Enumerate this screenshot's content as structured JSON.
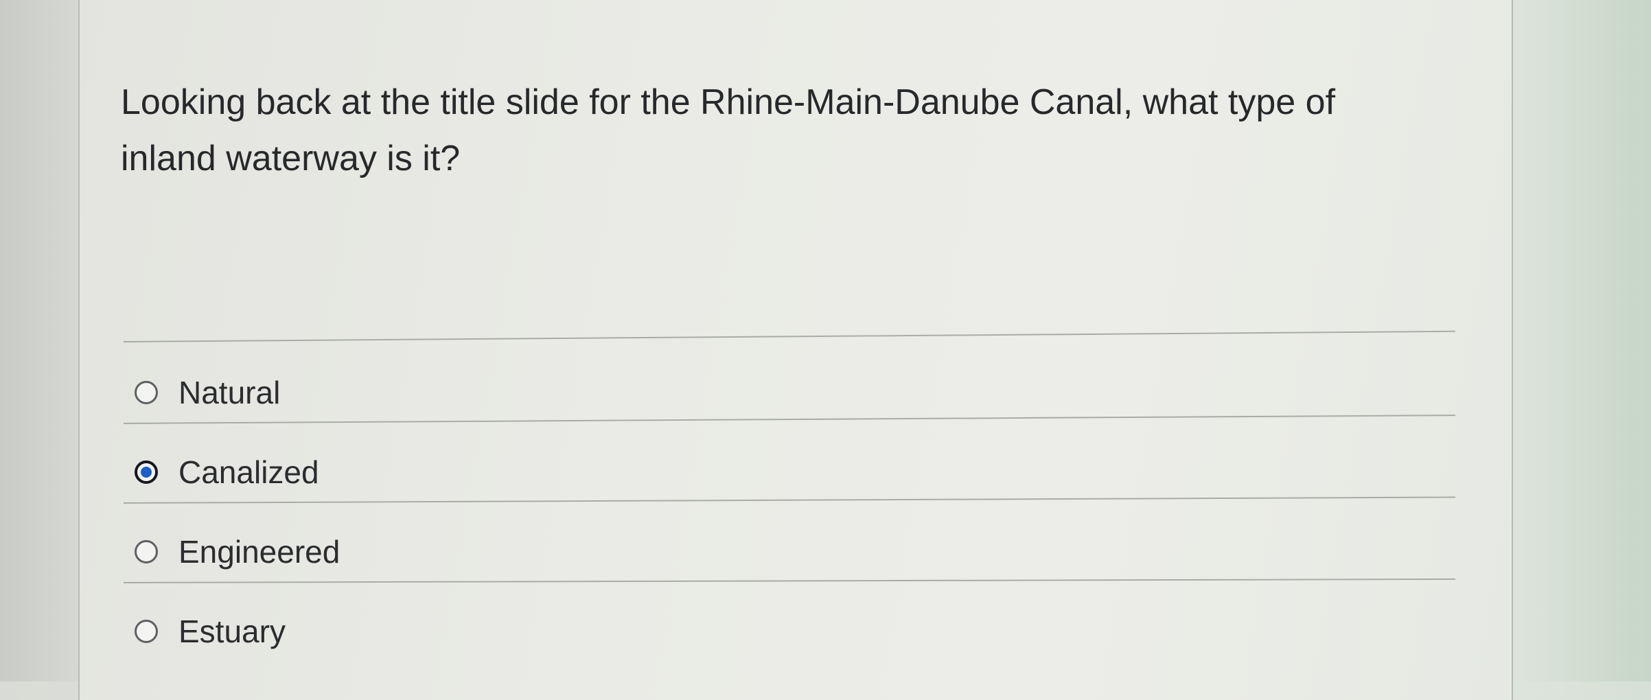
{
  "question": {
    "text": "Looking back at the title slide for the Rhine-Main-Danube Canal, what type of inland waterway is it?"
  },
  "options": [
    {
      "label": "Natural",
      "selected": false
    },
    {
      "label": "Canalized",
      "selected": true
    },
    {
      "label": "Engineered",
      "selected": false
    },
    {
      "label": "Estuary",
      "selected": false
    }
  ],
  "colors": {
    "selected_radio_fill": "#1d5ec7",
    "text": "#26282b"
  }
}
